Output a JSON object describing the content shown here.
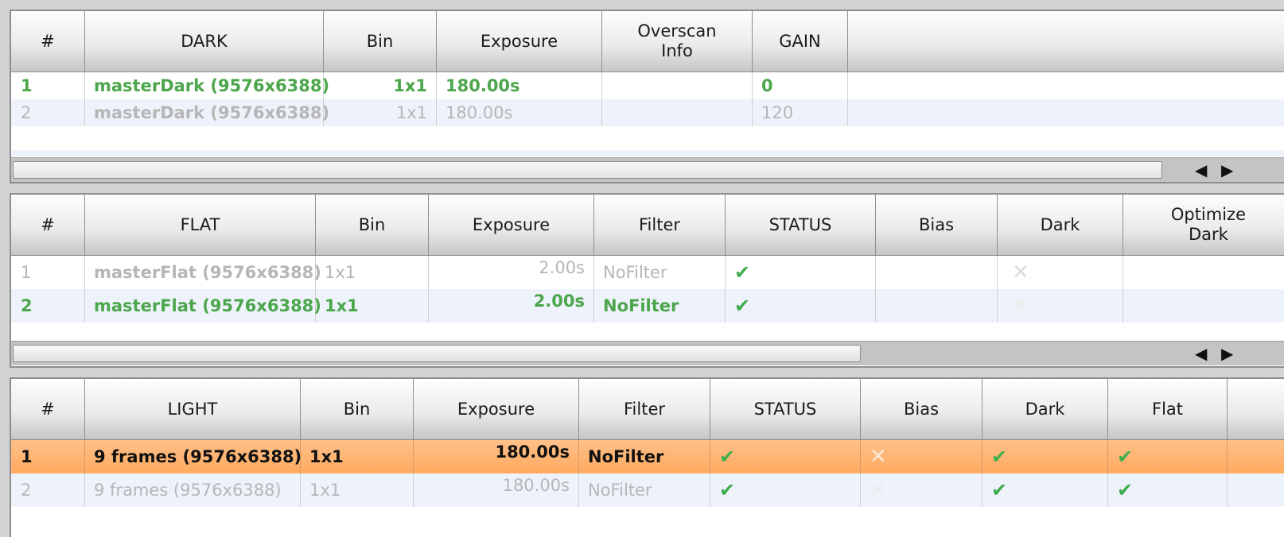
{
  "dark": {
    "headers": [
      "#",
      "DARK",
      "Bin",
      "Exposure",
      "Overscan\nInfo",
      "GAIN"
    ],
    "rows": [
      {
        "num": "1",
        "name": "masterDark (9576x6388)",
        "bin": "1x1",
        "exposure": "180.00s",
        "overscan": "",
        "gain": "0"
      },
      {
        "num": "2",
        "name": "masterDark (9576x6388)",
        "bin": "1x1",
        "exposure": "180.00s",
        "overscan": "",
        "gain": "120"
      }
    ],
    "scroll_left_icon": "◀",
    "scroll_right_icon": "▶"
  },
  "flat": {
    "headers": [
      "#",
      "FLAT",
      "Bin",
      "Exposure",
      "Filter",
      "STATUS",
      "Bias",
      "Dark",
      "Optimize\nDark"
    ],
    "rows": [
      {
        "num": "1",
        "name": "masterFlat (9576x6388)",
        "bin": "1x1",
        "exposure": "2.00s",
        "filter": "NoFilter",
        "status": "✔",
        "bias": "",
        "dark": "✕",
        "optimize_dark": ""
      },
      {
        "num": "2",
        "name": "masterFlat (9576x6388)",
        "bin": "1x1",
        "exposure": "2.00s",
        "filter": "NoFilter",
        "status": "✔",
        "bias": "",
        "dark": "✕",
        "optimize_dark": ""
      }
    ],
    "scroll_left_icon": "◀",
    "scroll_right_icon": "▶"
  },
  "light": {
    "headers": [
      "#",
      "LIGHT",
      "Bin",
      "Exposure",
      "Filter",
      "STATUS",
      "Bias",
      "Dark",
      "Flat"
    ],
    "rows": [
      {
        "num": "1",
        "name": "9 frames (9576x6388)",
        "bin": "1x1",
        "exposure": "180.00s",
        "filter": "NoFilter",
        "status": "✔",
        "bias": "✕",
        "dark": "✔",
        "flat": "✔"
      },
      {
        "num": "2",
        "name": "9 frames (9576x6388)",
        "bin": "1x1",
        "exposure": "180.00s",
        "filter": "NoFilter",
        "status": "✔",
        "bias": "✕",
        "dark": "✔",
        "flat": "✔"
      }
    ]
  },
  "colors": {
    "active_text": "#4ca64c",
    "inactive_text": "#b6b6b6",
    "selected_row": "#ffaa5e",
    "alt_row": "#eef3fb",
    "check": "#3fae4e"
  },
  "icons": {
    "status_ok": "checkmark-icon",
    "status_missing": "cross-icon",
    "scroll_left": "triangle-left-icon",
    "scroll_right": "triangle-right-icon"
  }
}
